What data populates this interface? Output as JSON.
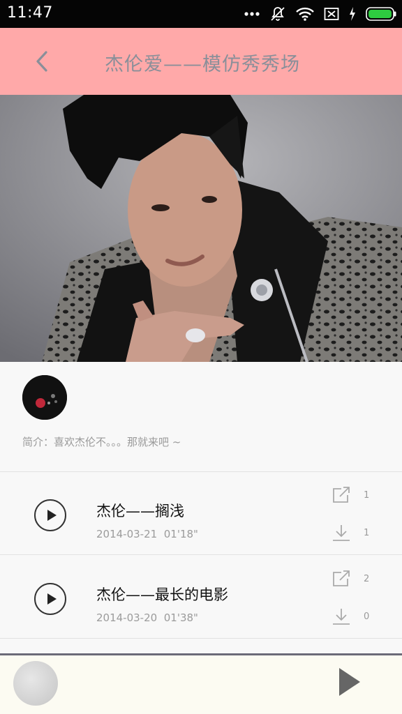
{
  "status_bar": {
    "time": "11:47"
  },
  "header": {
    "title": "杰伦爱——模仿秀秀场"
  },
  "info": {
    "intro": "简介：喜欢杰伦不。。。那就来吧 ~"
  },
  "tracks": [
    {
      "title": "杰伦——搁浅",
      "date": "2014-03-21",
      "duration": "01'18\"",
      "share_count": "1",
      "download_count": "1"
    },
    {
      "title": "杰伦——最长的电影",
      "date": "2014-03-20",
      "duration": "01'38\"",
      "share_count": "2",
      "download_count": "0"
    }
  ],
  "colors": {
    "header_bg": "#ffa9a9",
    "title_text": "#8a8f99",
    "player_bg": "#fcfbf2",
    "battery": "#2ecc40"
  },
  "icons": [
    "back-arrow-icon",
    "share-icon",
    "download-icon",
    "play-icon",
    "wifi-icon",
    "silent-icon",
    "sim-icon",
    "battery-icon"
  ]
}
